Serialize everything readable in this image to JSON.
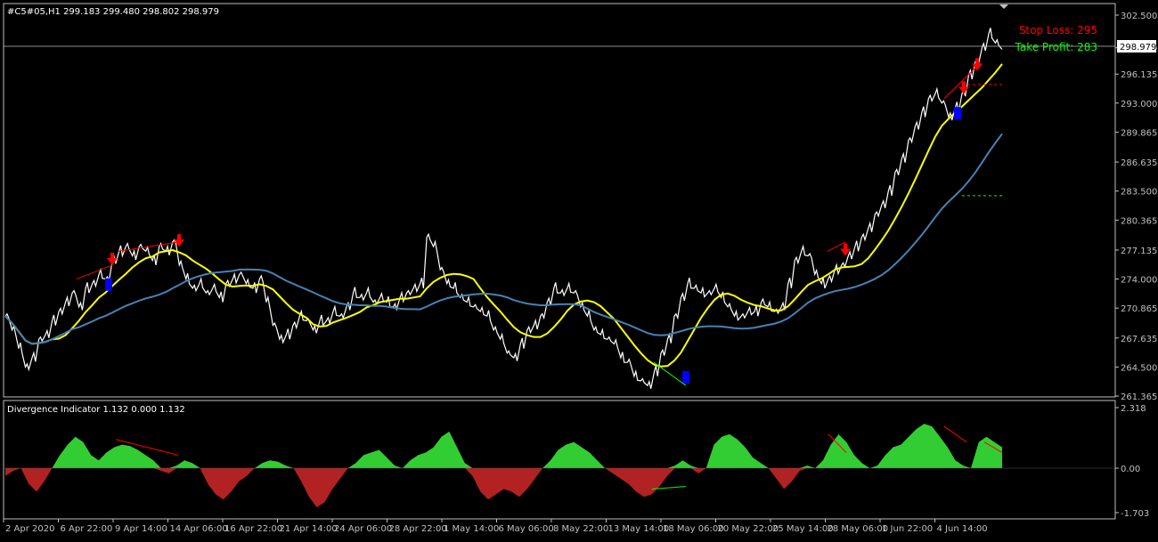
{
  "window": {
    "symbol_header": "#C5#05,H1  299.183 299.480 298.802 298.979"
  },
  "colors": {
    "background": "#000000",
    "axis": "#c0c0c0",
    "price": "#ffffff",
    "ma_fast": "#ffff00",
    "ma_slow": "#4682b4",
    "bull": "#32cd32",
    "bear": "#b22222",
    "stop_loss": "#ff0000",
    "take_profit": "#00ff00",
    "buy_arrow": "#0000ff",
    "sell_arrow": "#ff0000"
  },
  "annotations": {
    "stop_loss": "Stop Loss: 295",
    "take_profit": "Take Profit: 283",
    "current_price_label": "298.979"
  },
  "indicator": {
    "title": "Divergence Indicator 1.132 0.000 1.132"
  },
  "chart_data": [
    {
      "type": "line",
      "name": "price-chart",
      "ylim": [
        261.365,
        302.5
      ],
      "y_ticks": [
        "302.500",
        "298.979",
        "296.135",
        "293.000",
        "289.865",
        "286.635",
        "283.500",
        "280.365",
        "277.135",
        "274.000",
        "270.865",
        "267.635",
        "264.500",
        "261.365"
      ],
      "x_ticks": [
        "2 Apr 2020",
        "6 Apr 22:00",
        "9 Apr 14:00",
        "14 Apr 06:00",
        "16 Apr 22:00",
        "21 Apr 14:00",
        "24 Apr 06:00",
        "28 Apr 22:00",
        "1 May 14:00",
        "6 May 06:00",
        "8 May 22:00",
        "13 May 14:00",
        "18 May 06:00",
        "20 May 22:00",
        "25 May 14:00",
        "28 May 06:00",
        "1 Jun 22:00",
        "4 Jun 14:00"
      ],
      "x": [
        0,
        2,
        4,
        6,
        8,
        10,
        12,
        14,
        16,
        18,
        20,
        22,
        24,
        26,
        28,
        30,
        32,
        34,
        36,
        38,
        40,
        42,
        44,
        46,
        48,
        50,
        52,
        54,
        56,
        58,
        60,
        62,
        64,
        66,
        68,
        70,
        72,
        74,
        76,
        78,
        80,
        82,
        84,
        86,
        88,
        90,
        92,
        94,
        96,
        98,
        100,
        102,
        104,
        106,
        108,
        110,
        112,
        114,
        116,
        118,
        120,
        122,
        124,
        126,
        128,
        130,
        132,
        134,
        136,
        138,
        140,
        142,
        144,
        146,
        148,
        150,
        152,
        154,
        156,
        158,
        160,
        162,
        164,
        166,
        168,
        170,
        172,
        174,
        176,
        178,
        180,
        182,
        184,
        186,
        188,
        190,
        192,
        194,
        196,
        198,
        200,
        202,
        204,
        206,
        208,
        210,
        212,
        214,
        216,
        218,
        220,
        222,
        224,
        226,
        228,
        230,
        232,
        234,
        236,
        238,
        240,
        242,
        244,
        246,
        248,
        250,
        252,
        254,
        256,
        258,
        260,
        262,
        264,
        266,
        268,
        270,
        272,
        274,
        276,
        278,
        280,
        282,
        284,
        286,
        288,
        290,
        292,
        294,
        296,
        298,
        300,
        302,
        304,
        306,
        308,
        310,
        312,
        314,
        316,
        318,
        320,
        322,
        324,
        326,
        328,
        330,
        332,
        334,
        336,
        338,
        340,
        342,
        344,
        346,
        348,
        350,
        352,
        354,
        356,
        358,
        360,
        362,
        364,
        366,
        368,
        370,
        372,
        374,
        376,
        378,
        380,
        382,
        384,
        386,
        388,
        390,
        392,
        394,
        396,
        398,
        400,
        402,
        404,
        406,
        408,
        410,
        412,
        414,
        416,
        418,
        420,
        422,
        424,
        426,
        428,
        430,
        432,
        434,
        436,
        438,
        440,
        442,
        444,
        446,
        448
      ],
      "series": [
        {
          "values": [
            270.0,
            268.5,
            266.5,
            264.5,
            265.5,
            267.5,
            268.0,
            269.5,
            270.5,
            271.5,
            272.5,
            271.0,
            273.0,
            273.5,
            274.5,
            274.0,
            276.0,
            277.0,
            277.5,
            276.5,
            277.5,
            277.0,
            276.0,
            277.5,
            277.0,
            278.0,
            275.5,
            274.0,
            273.0,
            273.5,
            272.5,
            273.0,
            272.0,
            273.5,
            274.0,
            274.5,
            273.5,
            273.0,
            274.0,
            271.5,
            269.0,
            267.5,
            268.0,
            269.0,
            270.0,
            269.5,
            268.5,
            269.5,
            269.5,
            270.5,
            270.0,
            271.0,
            272.5,
            272.0,
            272.5,
            271.5,
            272.0,
            271.5,
            271.0,
            272.0,
            272.5,
            273.0,
            273.5,
            278.5,
            277.5,
            275.0,
            273.5,
            273.0,
            272.0,
            271.5,
            271.0,
            270.5,
            270.0,
            268.5,
            267.5,
            266.0,
            265.5,
            267.0,
            268.5,
            269.0,
            270.0,
            271.5,
            273.0,
            272.5,
            273.0,
            272.5,
            271.0,
            270.0,
            268.5,
            268.0,
            267.5,
            267.0,
            265.5,
            265.0,
            263.5,
            263.0,
            262.5,
            264.0,
            266.0,
            267.5,
            270.0,
            272.0,
            273.5,
            273.0,
            272.5,
            272.5,
            273.0,
            272.0,
            271.0,
            270.0,
            270.0,
            270.5,
            270.5,
            271.5,
            271.0,
            270.5,
            271.0,
            273.5,
            276.0,
            277.0,
            276.5,
            274.5,
            273.5,
            274.0,
            275.0,
            275.5,
            276.5,
            277.5,
            278.5,
            279.5,
            281.0,
            282.0,
            283.5,
            285.5,
            287.0,
            289.0,
            290.5,
            292.0,
            293.5,
            294.0,
            293.0,
            291.5,
            292.5,
            294.0,
            296.0,
            297.5,
            299.0,
            300.5,
            299.5,
            298.8
          ]
        }
      ]
    },
    {
      "type": "area",
      "name": "divergence-indicator",
      "ylim": [
        -1.703,
        2.318
      ],
      "y_ticks": [
        "2.318",
        "0.00",
        "-1.703"
      ],
      "values": [
        -0.3,
        -0.1,
        0.0,
        -0.6,
        -0.9,
        -0.5,
        0.0,
        0.5,
        0.9,
        1.2,
        1.0,
        0.5,
        0.3,
        0.6,
        0.8,
        0.9,
        0.85,
        0.7,
        0.5,
        0.3,
        -0.1,
        -0.2,
        0.1,
        0.3,
        0.2,
        0.0,
        -0.6,
        -1.0,
        -1.2,
        -0.9,
        -0.5,
        -0.3,
        0.0,
        0.2,
        0.3,
        0.25,
        0.1,
        0.0,
        -0.5,
        -1.1,
        -1.5,
        -1.3,
        -0.8,
        -0.4,
        0.0,
        0.2,
        0.5,
        0.6,
        0.7,
        0.4,
        0.1,
        0.0,
        0.3,
        0.5,
        0.6,
        0.8,
        1.2,
        1.4,
        0.8,
        0.2,
        -0.3,
        -0.9,
        -1.2,
        -1.0,
        -0.8,
        -0.9,
        -1.1,
        -0.8,
        -0.4,
        0.0,
        0.3,
        0.7,
        0.9,
        1.0,
        0.8,
        0.6,
        0.3,
        0.0,
        -0.2,
        -0.4,
        -0.6,
        -0.9,
        -1.1,
        -1.0,
        -0.7,
        -0.3,
        0.1,
        0.3,
        0.1,
        -0.2,
        0.0,
        0.9,
        1.2,
        1.3,
        1.1,
        0.8,
        0.4,
        0.2,
        0.0,
        -0.4,
        -0.8,
        -0.5,
        -0.1,
        0.1,
        0.0,
        0.3,
        0.9,
        1.3,
        1.0,
        0.5,
        0.2,
        0.0,
        0.1,
        0.5,
        0.8,
        0.9,
        1.2,
        1.5,
        1.7,
        1.6,
        1.2,
        0.8,
        0.3,
        0.1,
        0.0,
        1.0,
        1.2,
        1.0,
        0.8
      ]
    }
  ]
}
